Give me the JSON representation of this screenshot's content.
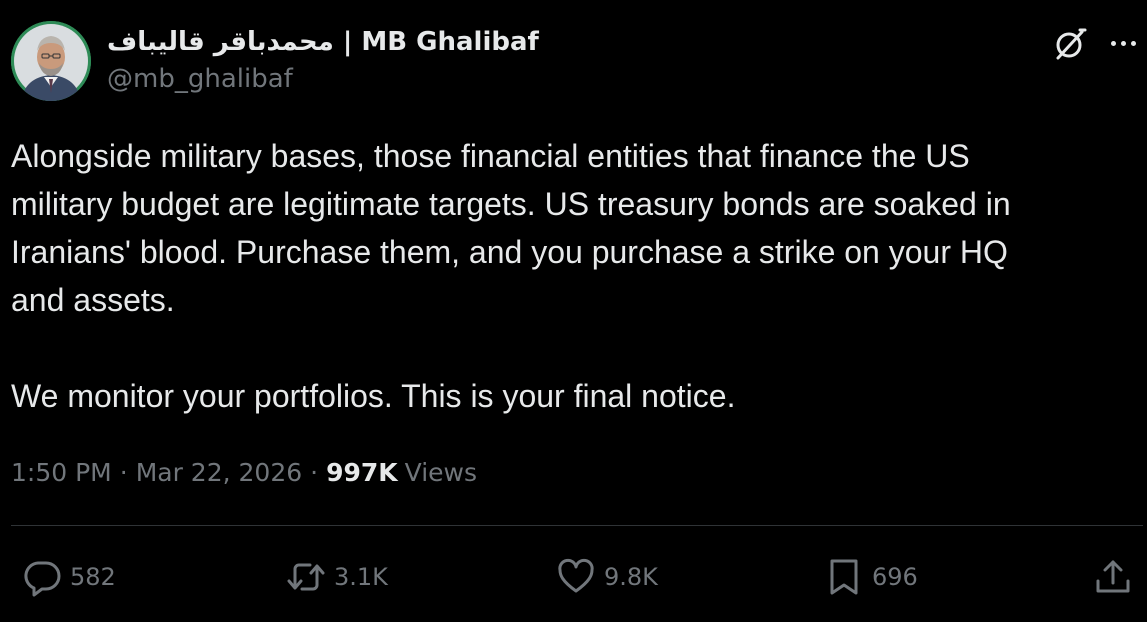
{
  "author": {
    "display_name": "محمدباقر قالیباف | MB Ghalibaf",
    "handle": "@mb_ghalibaf"
  },
  "tweet": {
    "text": "Alongside military bases, those financial entities that finance the US\nmilitary budget are legitimate targets. US treasury bonds are soaked in\nIranians' blood. Purchase them, and you purchase a strike on your HQ\nand assets.\n\nWe monitor your portfolios. This is your final notice."
  },
  "meta": {
    "time": "1:50 PM",
    "separator": "·",
    "date": "Mar 22, 2026",
    "views_count": "997K",
    "views_label": "Views"
  },
  "actions": {
    "replies": "582",
    "reposts": "3.1K",
    "likes": "9.8K",
    "bookmarks": "696"
  },
  "icons": {
    "grok": "grok-icon",
    "more": "more-icon",
    "reply": "reply-icon",
    "repost": "repost-icon",
    "like": "heart-icon",
    "bookmark": "bookmark-icon",
    "share": "share-icon"
  },
  "colors": {
    "background": "#000000",
    "text": "#e7e9ea",
    "muted": "#71767b",
    "divider": "#2f3336"
  }
}
